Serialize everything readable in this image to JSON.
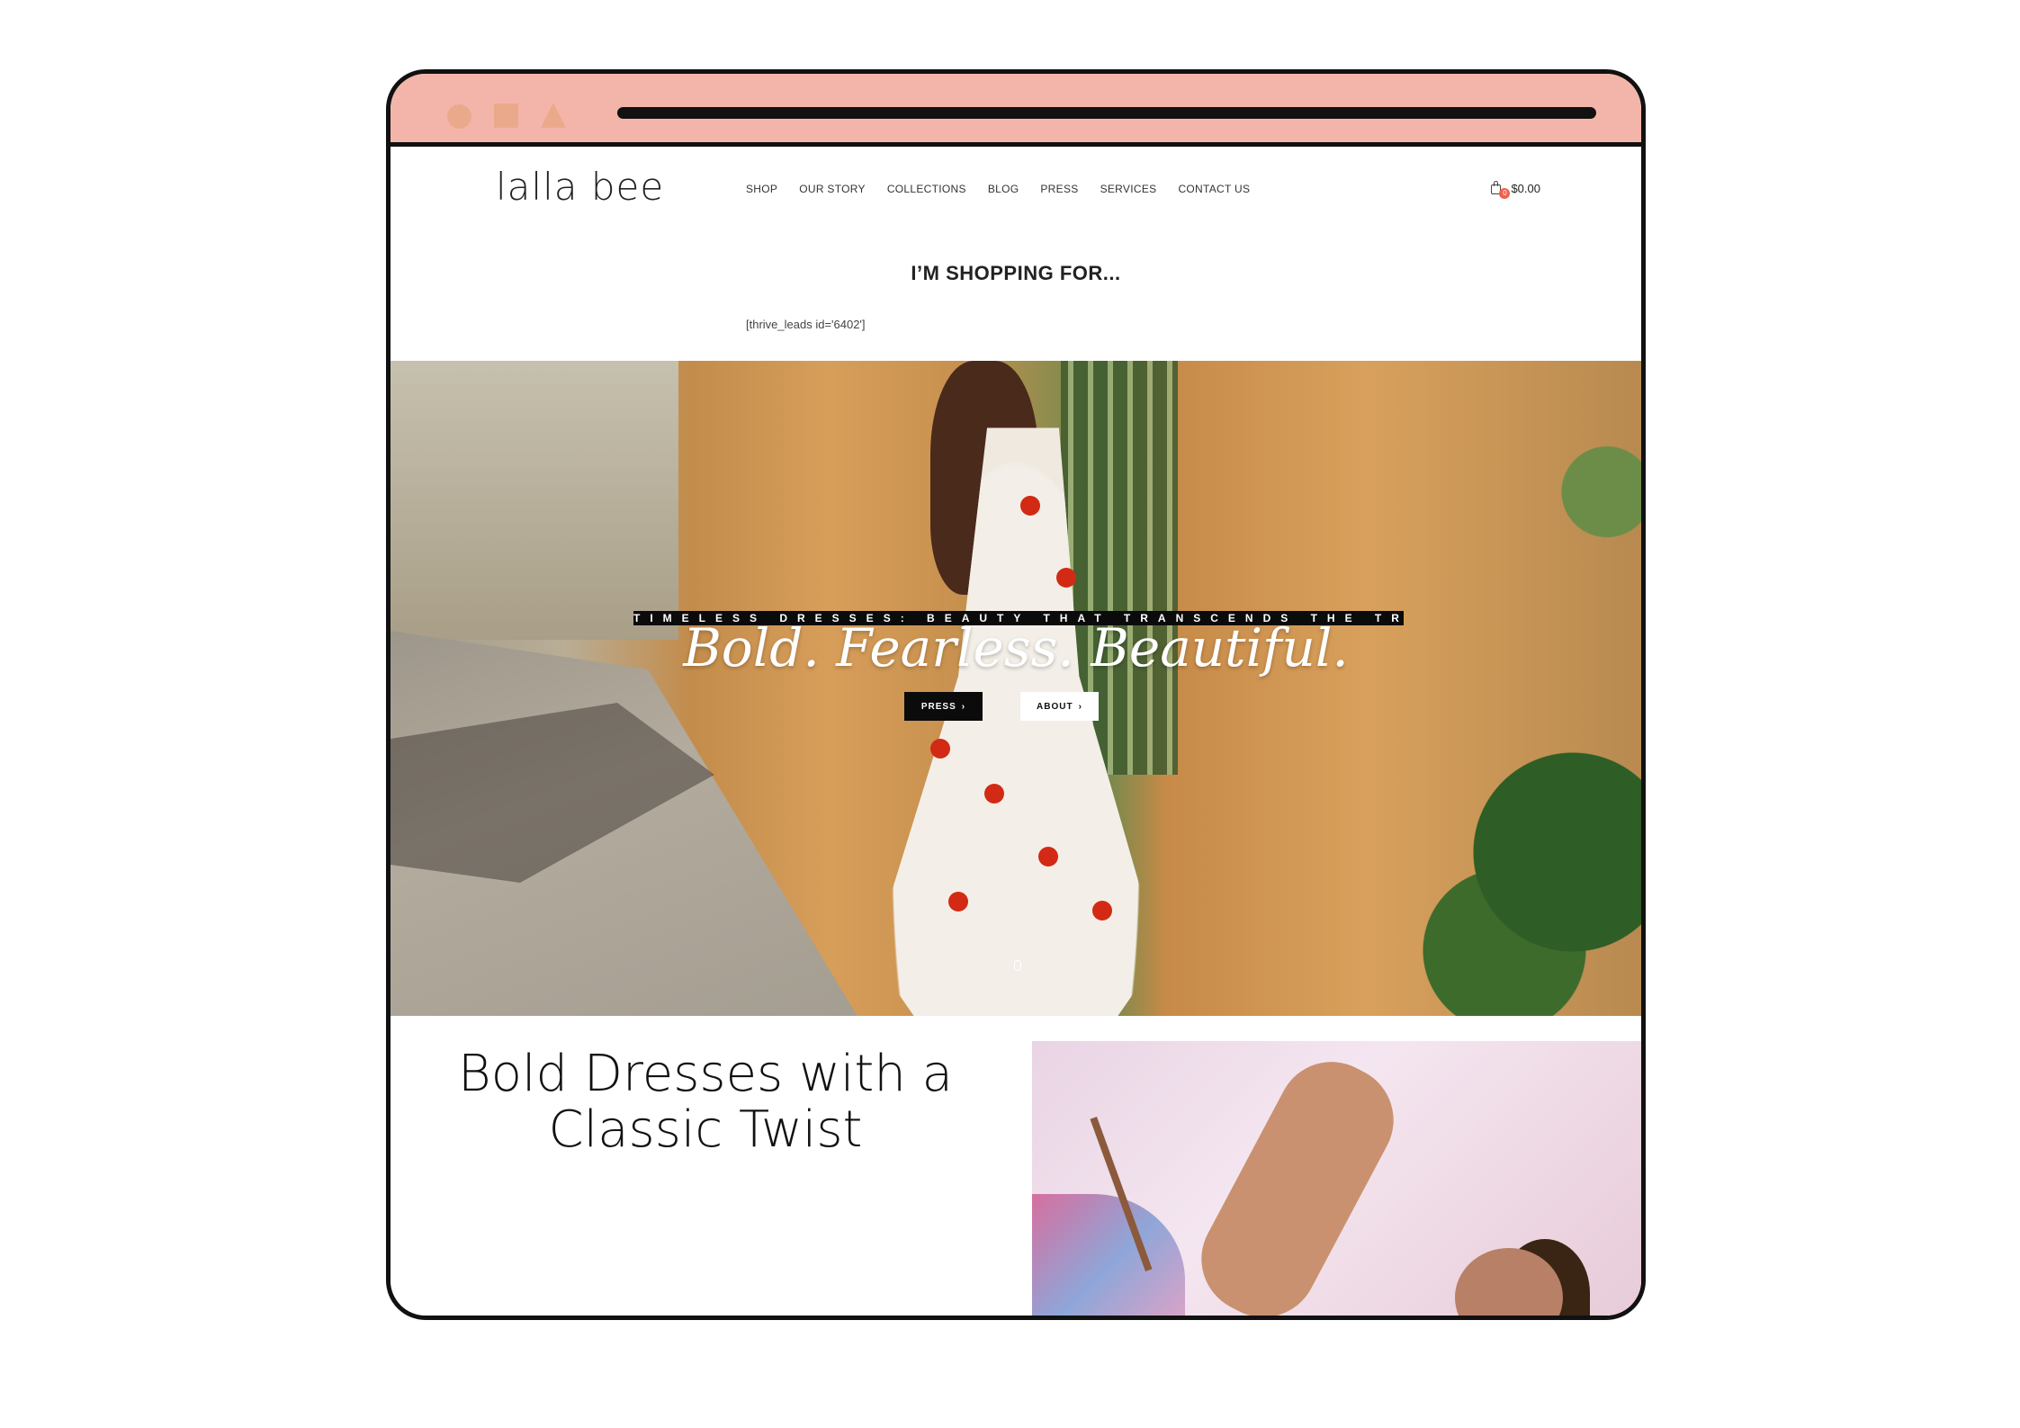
{
  "header": {
    "logo": "lalla bee",
    "nav": [
      "SHOP",
      "OUR STORY",
      "COLLECTIONS",
      "BLOG",
      "PRESS",
      "SERVICES",
      "CONTACT US"
    ],
    "cart_count": "0",
    "cart_total": "$0.00"
  },
  "intro": {
    "heading": "I’M SHOPPING FOR...",
    "shortcode": "[thrive_leads id='6402']"
  },
  "hero": {
    "tagline": "TIMELESS DRESSES: BEAUTY THAT TRANSCENDS THE TREND.",
    "title": "Bold. Fearless. Beautiful.",
    "press_label": "PRESS",
    "about_label": "ABOUT",
    "chevron": "›"
  },
  "feature": {
    "title": "Bold Dresses with a Classic Twist"
  },
  "colors": {
    "chrome": "#f3b5a9",
    "chrome_shapes": "#eba98b",
    "badge": "#f0604a"
  }
}
